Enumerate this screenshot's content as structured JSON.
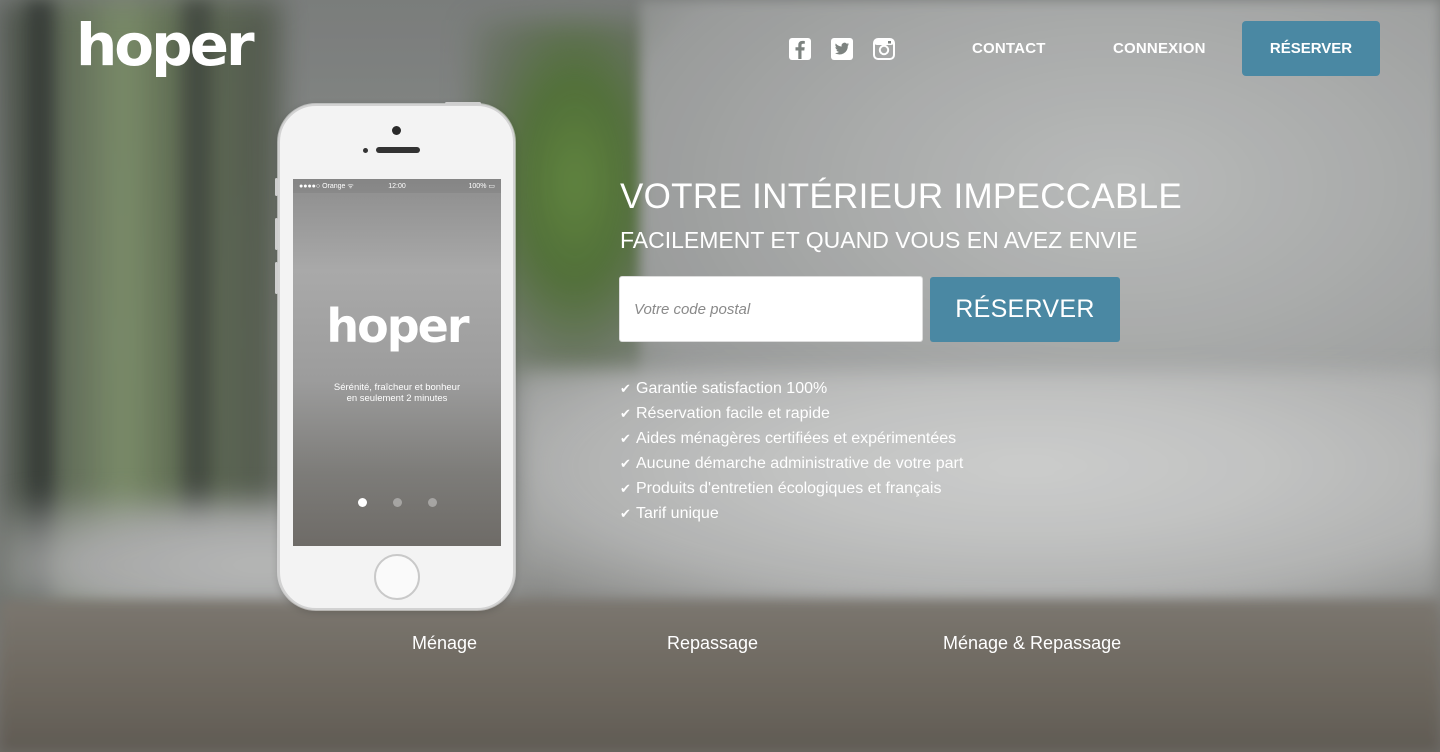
{
  "header": {
    "logo": "hoper",
    "social": [
      {
        "icon": "facebook-icon"
      },
      {
        "icon": "twitter-icon"
      },
      {
        "icon": "instagram-icon"
      }
    ],
    "nav": {
      "contact": "CONTACT",
      "login": "CONNEXION",
      "reserve": "RÉSERVER"
    }
  },
  "phone": {
    "status": {
      "carrier": "●●●●○ Orange ᯤ",
      "time": "12:00",
      "battery": "100% ▭"
    },
    "logo": "hoper",
    "tagline_line1": "Sérénité, fraîcheur et bonheur",
    "tagline_line2": "en seulement 2 minutes",
    "carousel_active_index": 0,
    "carousel_count": 3
  },
  "hero": {
    "title": "VOTRE INTÉRIEUR IMPECCABLE",
    "subtitle": "FACILEMENT ET QUAND VOUS EN AVEZ ENVIE",
    "postal_placeholder": "Votre code postal",
    "postal_value": "",
    "reserve_button": "RÉSERVER",
    "features": [
      "Garantie satisfaction 100%",
      "Réservation facile et rapide",
      "Aides ménagères certifiées et expérimentées",
      "Aucune démarche administrative de votre part",
      "Produits d'entretien écologiques et français",
      "Tarif unique"
    ],
    "check_glyph": "✔"
  },
  "services": {
    "menage": "Ménage",
    "repassage": "Repassage",
    "both": "Ménage & Repassage"
  },
  "colors": {
    "accent": "#4a88a3",
    "text": "#ffffff"
  }
}
